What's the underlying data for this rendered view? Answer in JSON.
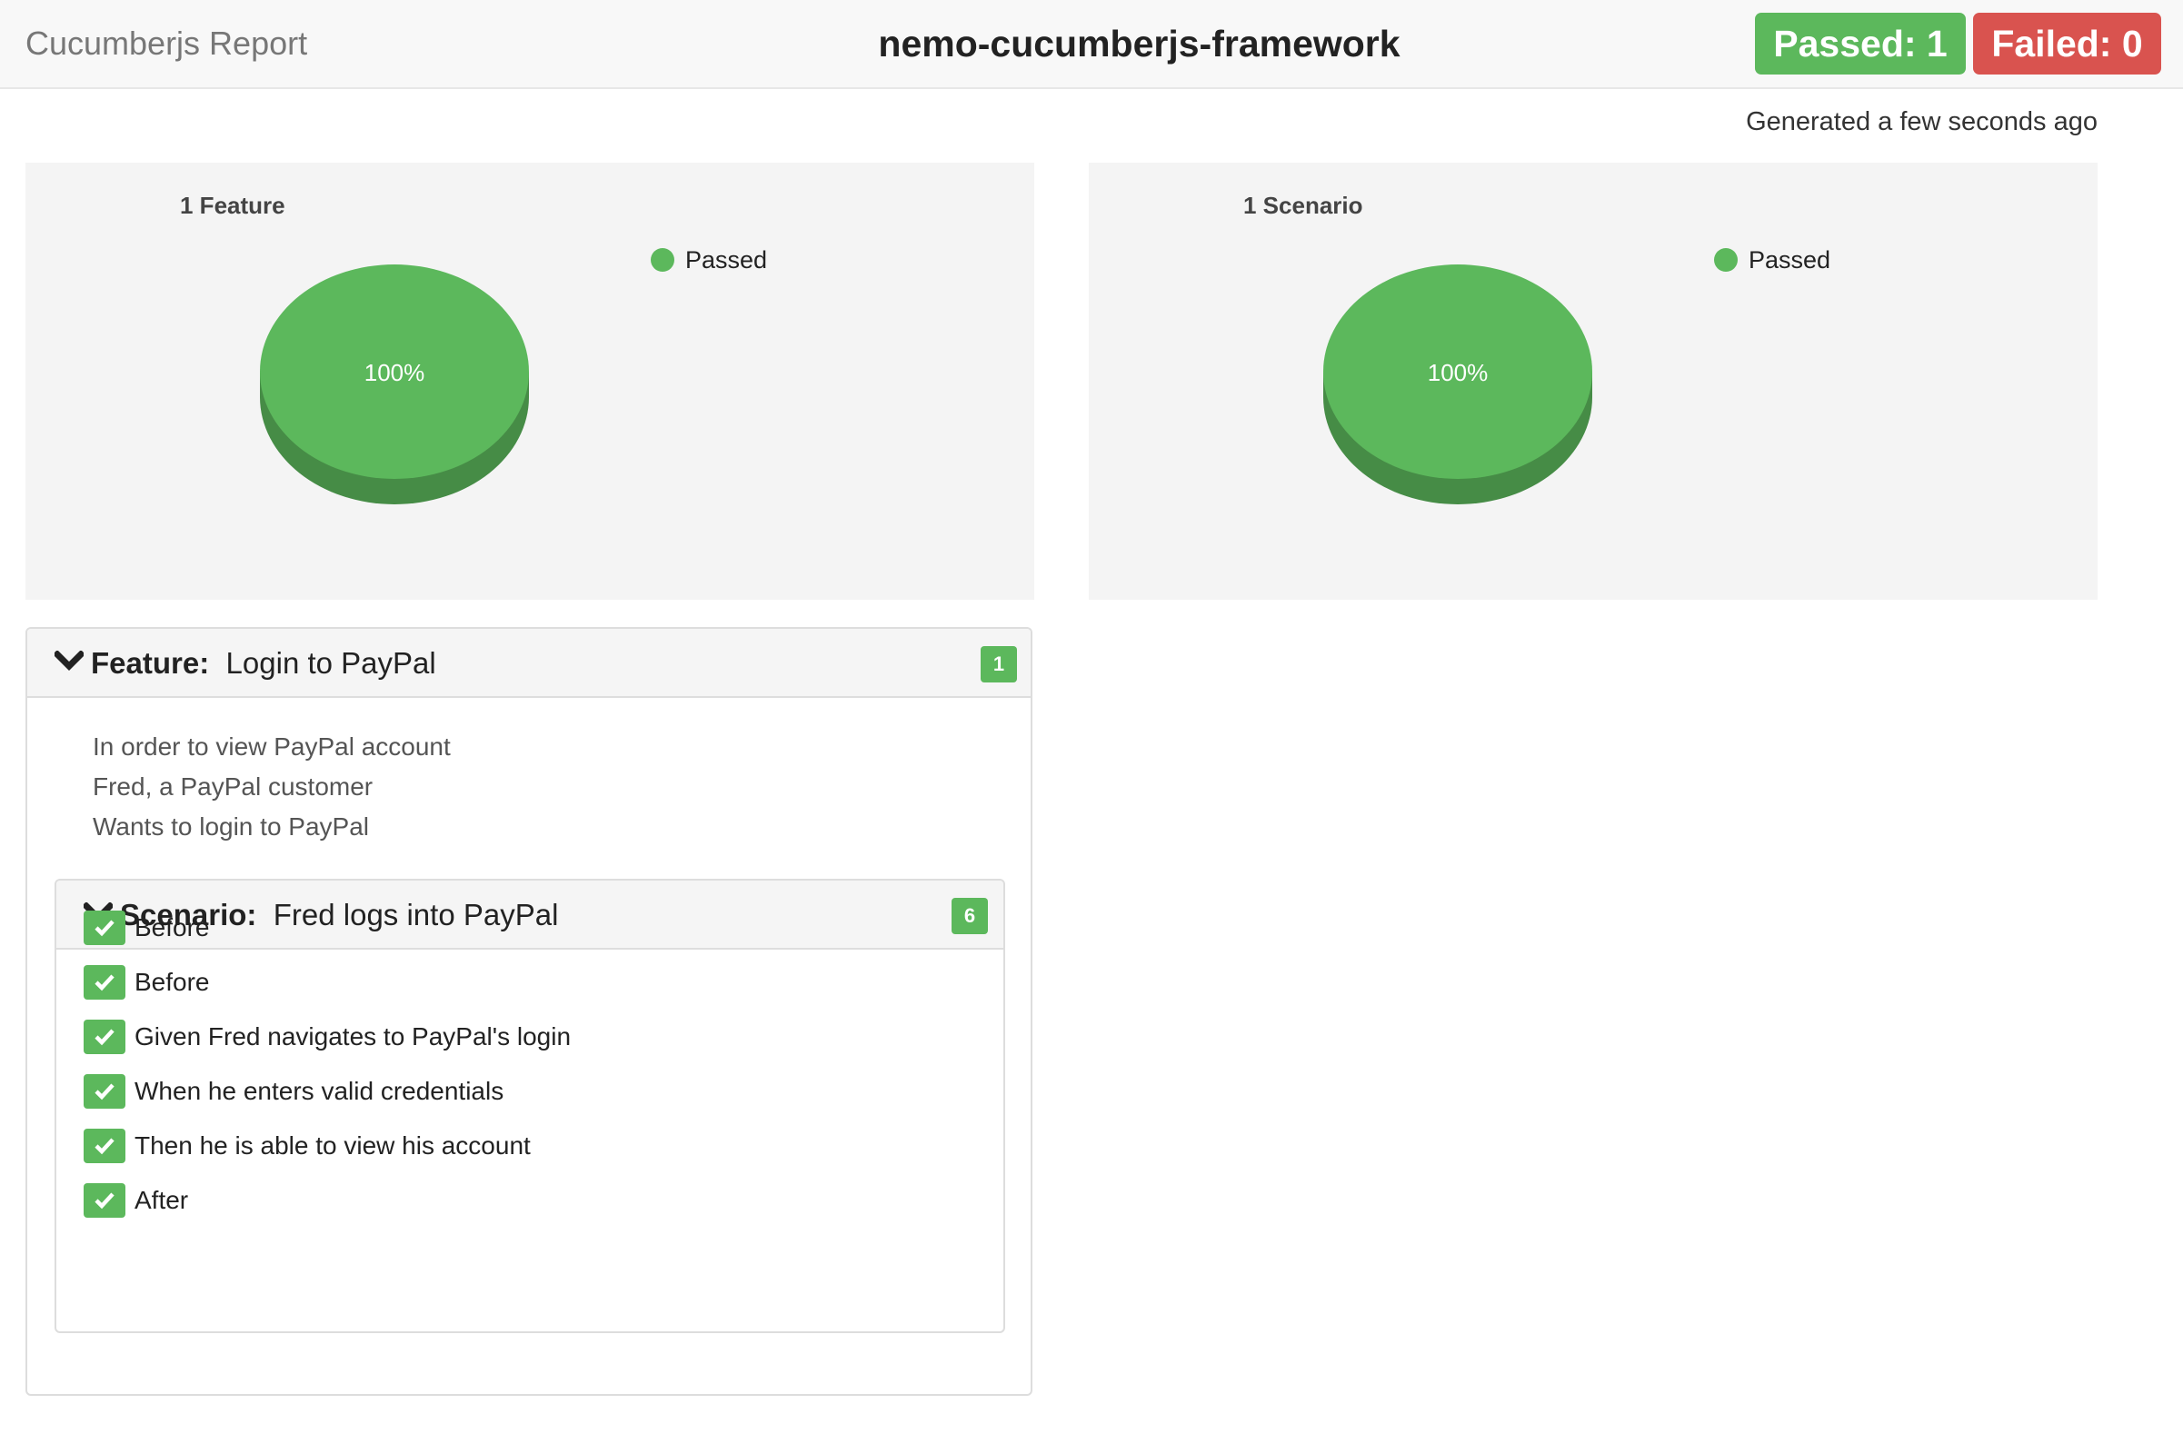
{
  "navbar": {
    "brand": "Cucumberjs Report",
    "project_title": "nemo-cucumberjs-framework",
    "passed_label": "Passed: 1",
    "failed_label": "Failed: 0"
  },
  "generated": "Generated a few seconds ago",
  "colors": {
    "passed": "#5cb85c",
    "failed": "#d9534f",
    "pie_top": "#5cb85c",
    "pie_side": "#468c46"
  },
  "chart_data": [
    {
      "type": "pie",
      "title": "1 Feature",
      "legend": [
        "Passed"
      ],
      "legend_position": "top-right",
      "slices": [
        {
          "label": "Passed",
          "value": 100,
          "data_label": "100%"
        }
      ]
    },
    {
      "type": "pie",
      "title": "1 Scenario",
      "legend": [
        "Passed"
      ],
      "legend_position": "top-right",
      "slices": [
        {
          "label": "Passed",
          "value": 100,
          "data_label": "100%"
        }
      ]
    }
  ],
  "feature": {
    "keyword": "Feature:",
    "name": "Login to PayPal",
    "count": "1",
    "description": [
      "In order to view PayPal account",
      "Fred, a PayPal customer",
      "Wants to login to PayPal"
    ],
    "scenario": {
      "keyword": "Scenario:",
      "name": "Fred logs into PayPal",
      "count": "6",
      "steps": [
        "Before",
        "Before",
        "Given Fred navigates to PayPal's login",
        "When he enters valid credentials",
        "Then he is able to view his account",
        "After"
      ]
    }
  }
}
